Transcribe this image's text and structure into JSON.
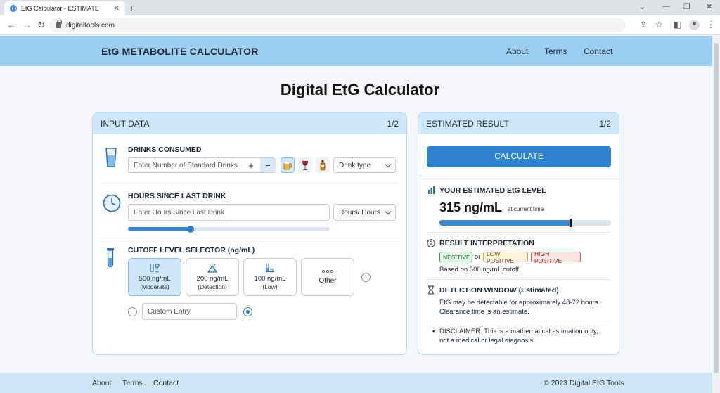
{
  "browser": {
    "tab_title": "EtG Calculator - ESTIMATE",
    "url": "digitaltools.com"
  },
  "header": {
    "brand": "EtG METABOLITE CALCULATOR",
    "nav": [
      "About",
      "Terms",
      "Contact"
    ]
  },
  "page": {
    "title": "Digital EtG Calculator"
  },
  "input_card": {
    "title": "INPUT DATA",
    "step": "1/2",
    "drinks": {
      "label": "DRINKS CONSUMED",
      "placeholder": "Enter Number of Standard Drinks",
      "plus": "+",
      "minus": "−",
      "drink_type": "Drink type",
      "icons": [
        "beer-icon",
        "wine-icon",
        "liquor-icon"
      ]
    },
    "hours": {
      "label": "HOURS SINCE LAST DRINK",
      "placeholder": "Enter Hours Since Last Drink",
      "unit_select": "Hours/ Hours",
      "slider_fraction": 0.31
    },
    "cutoff": {
      "label": "CUTOFF LEVEL SELECTOR (ng/mL)",
      "options": [
        {
          "value": "500 ng/mL",
          "sub": "(Moderate)",
          "selected": true
        },
        {
          "value": "200 ng/mL",
          "sub": "(Detection)",
          "selected": false
        },
        {
          "value": "100 ng/mL",
          "sub": "(Low)",
          "selected": false
        },
        {
          "value": "Other",
          "sub": "",
          "selected": false
        }
      ],
      "custom_placeholder": "Custom Entry"
    }
  },
  "result_card": {
    "title": "ESTIMATED RESULT",
    "step": "1/2",
    "calculate": "CALCULATE",
    "level": {
      "label": "YOUR ESTIMATED EtG LEVEL",
      "value": "315 ng/mL",
      "sub": "at current time",
      "bar_fraction": 0.76
    },
    "interpretation": {
      "label": "RESULT INTERPRETATION",
      "badges": [
        "NESITIVE",
        "LOW POSITIVE",
        "HIGH POSITIVE"
      ],
      "or": "or",
      "basis": "Based on 500 ng/mL cutoff."
    },
    "window": {
      "label": "DETECTION WINDOW (Estimated)",
      "line1": "EtG may be detectable for approximately 48-72 hours.",
      "line2": "Clearance time is an estimate."
    },
    "disclaimer": {
      "line1": "DISCLAIMER: This is a mathematical estimation only,",
      "line2": "not a medical or legal diagnosis."
    }
  },
  "footer": {
    "links": [
      "About",
      "Terms",
      "Contact"
    ],
    "copyright": "© 2023 Digital EtG Tools"
  },
  "colors": {
    "header_bg": "#9ccdf2",
    "accent": "#2f82cf",
    "card_head": "#cfe7fb",
    "badge_green": "#2e9e4f",
    "badge_yellow": "#d8b620",
    "badge_red": "#d9534f"
  }
}
